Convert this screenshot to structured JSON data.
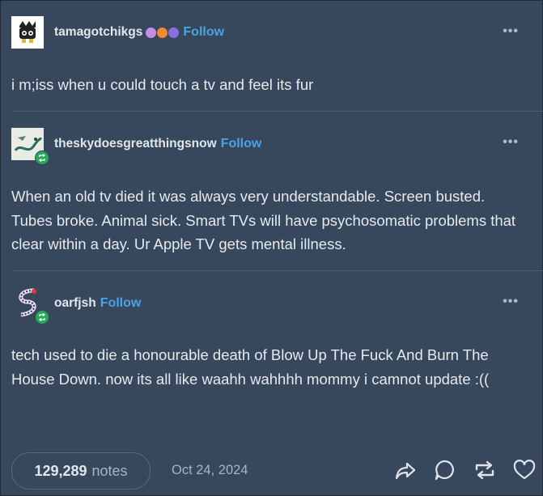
{
  "posts": [
    {
      "username": "tamagotchikgs",
      "follow": "Follow",
      "text": "i m;iss when u could touch a tv and feel its fur",
      "avatar": "tamagotchi-avatar",
      "badge_colors": [
        "#c78ce8",
        "#f08a34",
        "#8a6ee0"
      ]
    },
    {
      "username": "theskydoesgreatthingsnow",
      "follow": "Follow",
      "text": "When an old tv died it was always very understandable. Screen busted. Tubes broke. Animal sick. Smart TVs will have psychosomatic problems that clear within a day. Ur Apple TV gets mental illness.",
      "avatar": "dragon-sketch-avatar"
    },
    {
      "username": "oarfjsh",
      "follow": "Follow",
      "text": "tech used to die a honourable death of Blow Up The Fuck And Burn The House Down. now its all like waahh wahhhh mommy i camnot update :((",
      "avatar": "serpent-avatar"
    }
  ],
  "more_label": "•••",
  "footer": {
    "notes_count": "129,289",
    "notes_word": "notes",
    "date": "Oct 24, 2024",
    "actions": [
      "share-icon",
      "reply-icon",
      "reblog-icon",
      "like-icon"
    ]
  },
  "colors": {
    "background": "#37475c",
    "follow": "#4aa3e6",
    "reblog_badge": "#25a95a"
  }
}
